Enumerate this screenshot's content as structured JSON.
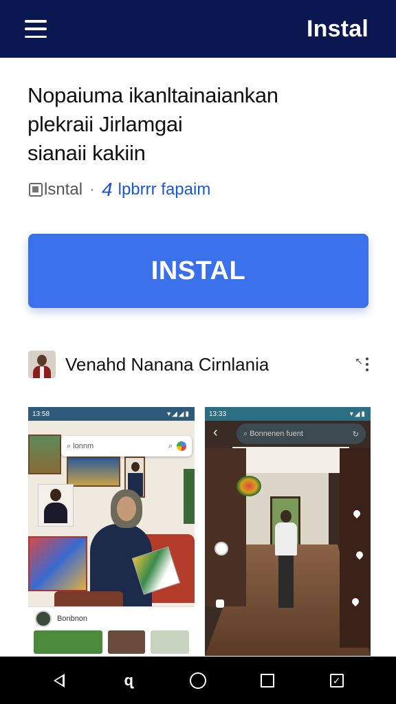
{
  "topbar": {
    "menu_icon": "hamburger-menu-icon",
    "brand": "Instal"
  },
  "headline": {
    "lines": [
      "Nopaiuma ikanltainaiankan",
      "plekraii Jirlamgai",
      "sianaii kakiin"
    ]
  },
  "meta": {
    "doc_icon": "document-icon",
    "label": "lsntal",
    "separator": "·",
    "count": "4",
    "link": "lpbrrr fapaim"
  },
  "install_button": {
    "label": "INSTAL",
    "color": "#3a70ea"
  },
  "developer": {
    "avatar": "developer-avatar",
    "name": "Venahd Nanana Cirnlania",
    "more_icon": "more-vertical-icon"
  },
  "screenshots": [
    {
      "status_time": "13:58",
      "status_icons": "▾◢◢▮",
      "search_text": "lonnm",
      "card_name": "Bonbnon"
    },
    {
      "status_time": "13:33",
      "status_icons": "▾◢▮",
      "search_text": "Bonnenen fuent",
      "back_icon": "back-arrow-icon"
    }
  ],
  "navbar": {
    "items": [
      "back-icon",
      "assistant-icon",
      "home-icon",
      "recents-icon",
      "notification-icon"
    ]
  },
  "colors": {
    "topbar": "#0b1750",
    "link": "#1a57d6",
    "navbar": "#000000"
  }
}
